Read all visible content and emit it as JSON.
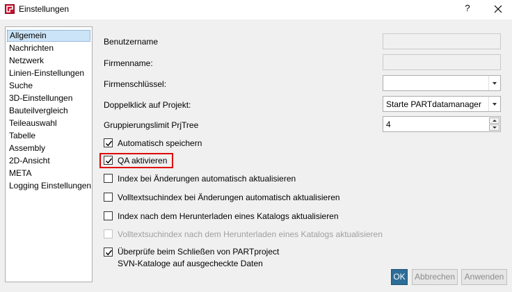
{
  "window": {
    "title": "Einstellungen",
    "help_label": "?",
    "close_label": "✕",
    "app_icon": "partsolutions-logo-icon"
  },
  "sidebar": {
    "items": [
      {
        "label": "Allgemein",
        "selected": true
      },
      {
        "label": "Nachrichten"
      },
      {
        "label": "Netzwerk"
      },
      {
        "label": "Linien-Einstellungen"
      },
      {
        "label": "Suche"
      },
      {
        "label": "3D-Einstellungen"
      },
      {
        "label": "Bauteilvergleich"
      },
      {
        "label": "Teileauswahl"
      },
      {
        "label": "Tabelle"
      },
      {
        "label": "Assembly"
      },
      {
        "label": "2D-Ansicht"
      },
      {
        "label": "META"
      },
      {
        "label": "Logging Einstellungen"
      }
    ]
  },
  "form": {
    "username_label": "Benutzername",
    "username_value": "",
    "company_label": "Firmenname:",
    "company_value": "",
    "company_key_label": "Firmenschlüssel:",
    "company_key_value": "",
    "doubleclick_label": "Doppelklick auf Projekt:",
    "doubleclick_value": "Starte PARTdatamanager",
    "grouping_label": "Gruppierungslimit PrjTree",
    "grouping_value": "4"
  },
  "checkboxes": [
    {
      "label": "Automatisch speichern",
      "checked": true,
      "enabled": true
    },
    {
      "label": "QA aktivieren",
      "checked": true,
      "enabled": true,
      "highlighted": true
    },
    {
      "label": "Index bei Änderungen automatisch aktualisieren",
      "checked": false,
      "enabled": true
    },
    {
      "label": "Volltextsuchindex bei Änderungen automatisch aktualisieren",
      "checked": false,
      "enabled": true
    },
    {
      "label": "Index nach dem Herunterladen eines Katalogs aktualisieren",
      "checked": false,
      "enabled": true
    },
    {
      "label": "Volltextsuchindex nach dem Herunterladen eines Katalogs aktualisieren",
      "checked": false,
      "enabled": false
    },
    {
      "label_line1": "Überprüfe beim Schließen von PARTproject",
      "label_line2": "SVN-Kataloge auf ausgecheckte Daten",
      "checked": true,
      "enabled": true
    }
  ],
  "buttons": {
    "ok": "OK",
    "cancel": "Abbrechen",
    "apply": "Anwenden"
  },
  "colors": {
    "highlight": "#e00000",
    "selection": "#cce4f7",
    "primary_button": "#2d6d97"
  }
}
